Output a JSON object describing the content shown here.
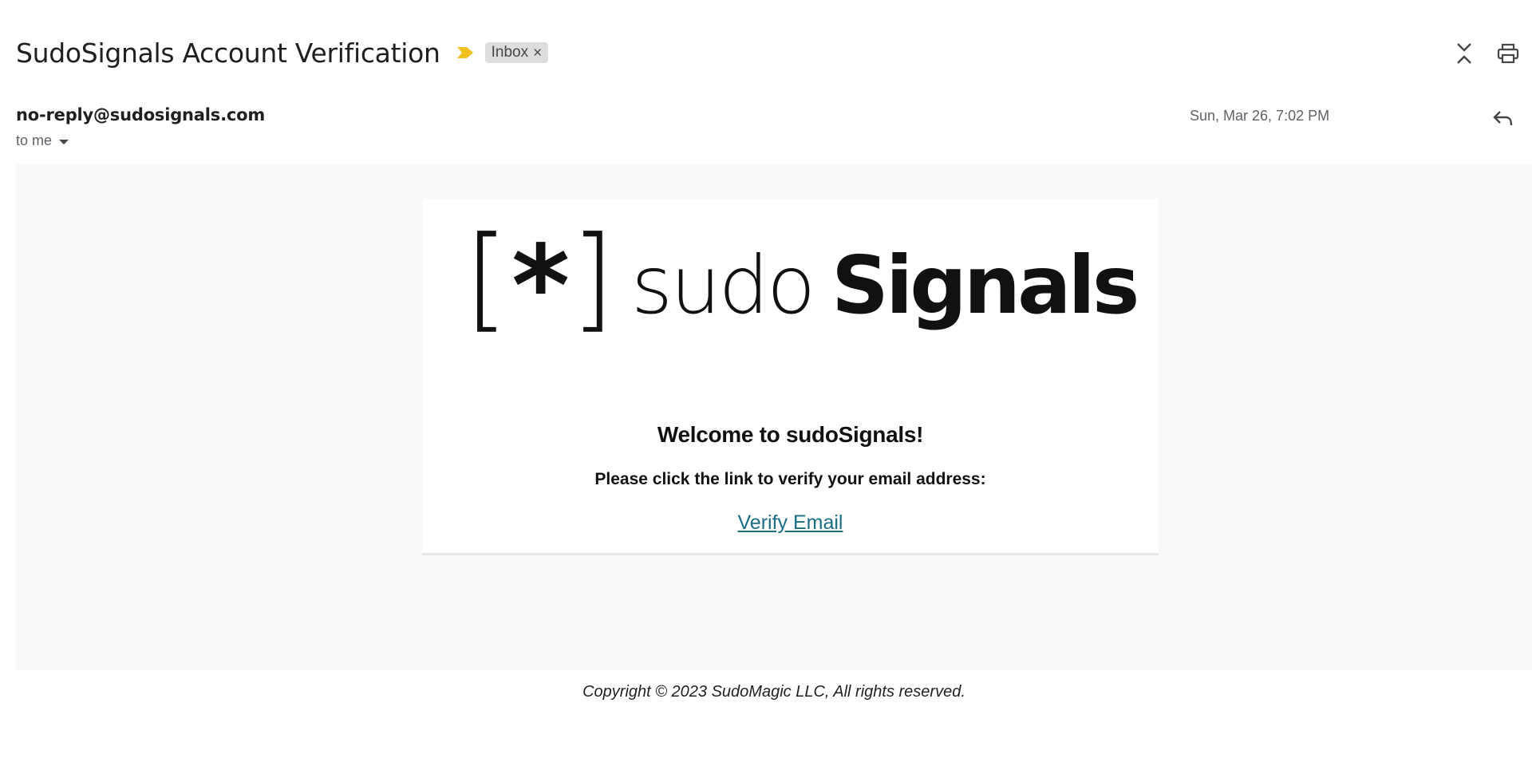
{
  "header": {
    "subject": "SudoSignals Account Verification",
    "label": "Inbox",
    "label_remove": "×",
    "importance_color": "#f2c01f"
  },
  "message": {
    "sender": "no-reply@sudosignals.com",
    "recipient": "to me",
    "date": "Sun, Mar 26, 7:02 PM"
  },
  "body": {
    "logo": {
      "bracket_open": "[",
      "star": "*",
      "bracket_close": "]",
      "light": "sudo",
      "bold": "Signals"
    },
    "welcome": "Welcome to sudoSignals!",
    "instruction": "Please click the link to verify your email address:",
    "link": "Verify Email",
    "link_color": "#1b6d86"
  },
  "footer": {
    "copyright": "Copyright © 2023 SudoMagic LLC, All rights reserved."
  },
  "icons": {
    "importance": "importance-marker-icon",
    "collapse": "collapse-all-icon",
    "print": "print-icon",
    "reply": "reply-icon",
    "recipient_dropdown": "caret-down-icon"
  }
}
